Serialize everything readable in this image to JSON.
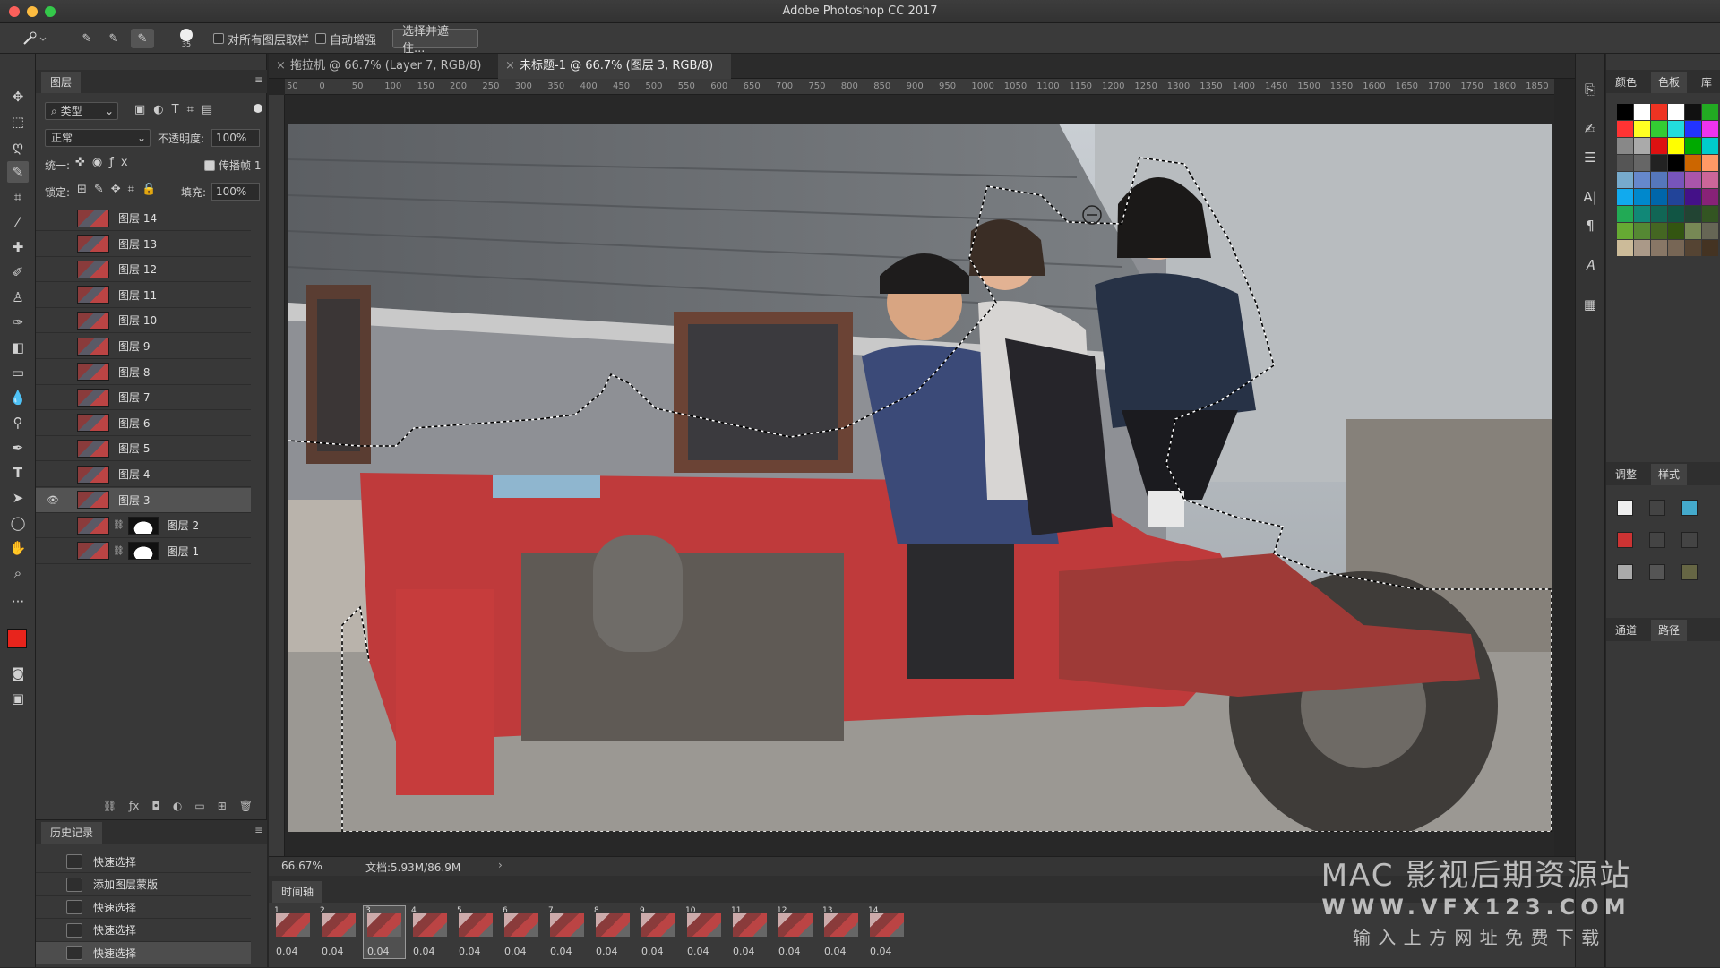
{
  "app": {
    "title": "Adobe Photoshop CC 2017"
  },
  "options_bar": {
    "brush_size": "35",
    "sample_all_layers": "对所有图层取样",
    "auto_enhance": "自动增强",
    "select_and_mask": "选择并遮住..."
  },
  "layers_panel": {
    "tab": "图层",
    "filter_kind": "类型",
    "blend_mode": "正常",
    "opacity_label": "不透明度:",
    "opacity_value": "100%",
    "unify_label": "统一:",
    "propagate_label": "传播帧 1",
    "lock_label": "锁定:",
    "fill_label": "填充:",
    "fill_value": "100%",
    "layers": [
      {
        "name": "图层 14"
      },
      {
        "name": "图层 13"
      },
      {
        "name": "图层 12"
      },
      {
        "name": "图层 11"
      },
      {
        "name": "图层 10"
      },
      {
        "name": "图层 9"
      },
      {
        "name": "图层 8"
      },
      {
        "name": "图层 7"
      },
      {
        "name": "图层 6"
      },
      {
        "name": "图层 5"
      },
      {
        "name": "图层 4"
      },
      {
        "name": "图层 3"
      },
      {
        "name": "图层 2"
      },
      {
        "name": "图层 1"
      }
    ]
  },
  "history_panel": {
    "tab": "历史记录",
    "items": [
      {
        "label": "快速选择"
      },
      {
        "label": "添加图层蒙版"
      },
      {
        "label": "快速选择"
      },
      {
        "label": "快速选择"
      },
      {
        "label": "快速选择"
      }
    ]
  },
  "document_tabs": [
    {
      "label": "拖拉机 @ 66.7% (Layer 7, RGB/8) *"
    },
    {
      "label": "未标题-1 @ 66.7% (图层 3, RGB/8) *"
    }
  ],
  "ruler_ticks": [
    "50",
    "0",
    "50",
    "100",
    "150",
    "200",
    "250",
    "300",
    "350",
    "400",
    "450",
    "500",
    "550",
    "600",
    "650",
    "700",
    "750",
    "800",
    "850",
    "900",
    "950",
    "1000",
    "1050",
    "1100",
    "1150",
    "1200",
    "1250",
    "1300",
    "1350",
    "1400",
    "1450",
    "1500",
    "1550",
    "1600",
    "1650",
    "1700",
    "1750",
    "1800",
    "1850",
    "190"
  ],
  "status_bar": {
    "zoom": "66.67%",
    "doc_size": "文档:5.93M/86.9M"
  },
  "timeline": {
    "tab": "时间轴",
    "frames": [
      {
        "num": "1",
        "delay": "0.04"
      },
      {
        "num": "2",
        "delay": "0.04"
      },
      {
        "num": "3",
        "delay": "0.04"
      },
      {
        "num": "4",
        "delay": "0.04"
      },
      {
        "num": "5",
        "delay": "0.04"
      },
      {
        "num": "6",
        "delay": "0.04"
      },
      {
        "num": "7",
        "delay": "0.04"
      },
      {
        "num": "8",
        "delay": "0.04"
      },
      {
        "num": "9",
        "delay": "0.04"
      },
      {
        "num": "10",
        "delay": "0.04"
      },
      {
        "num": "11",
        "delay": "0.04"
      },
      {
        "num": "12",
        "delay": "0.04"
      },
      {
        "num": "13",
        "delay": "0.04"
      },
      {
        "num": "14",
        "delay": "0.04"
      }
    ]
  },
  "right_panels": {
    "color_tab": "颜色",
    "swatches_tab": "色板",
    "library_tab": "库",
    "adjust_tab": "调整",
    "styles_tab": "样式",
    "channels_tab": "通道",
    "paths_tab": "路径"
  },
  "watermark": {
    "line1": "MAC 影视后期资源站",
    "line2": "WWW.VFX123.COM",
    "line3": "输 入 上 方 网 址   免 费 下 载"
  },
  "colors": {
    "foreground": "#e8241c",
    "background": "#ffffff",
    "tractor_red": "#c8393a"
  }
}
